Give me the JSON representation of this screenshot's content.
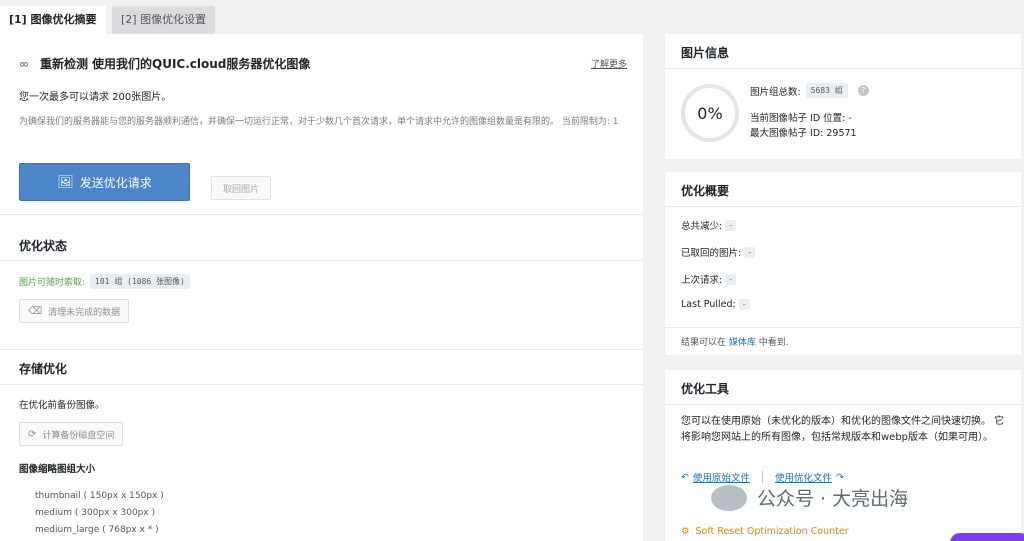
{
  "tabs": {
    "summary": "[1] 图像优化摘要",
    "settings": "[2] 图像优化设置"
  },
  "main": {
    "rescan_label": "重新检测",
    "headline": "使用我们的QUIC.cloud服务器优化图像",
    "learn_more": "了解更多",
    "max_request": "您一次最多可以请求 200张图片。",
    "note": "为确保我们的服务器能与您的服务器顺利通信，并确保一切运行正常，对于少数几个首次请求，单个请求中允许的图像组数量是有限的。 当前限制为: 1",
    "send_button": "发送优化请求",
    "pull_button": "取回图片",
    "status_title": "优化状态",
    "pullable_label": "图片可随时索取:",
    "pullable_value": "101 组 (1086 张图像)",
    "clean_button": "清理未完成的数据",
    "storage_title": "存储优化",
    "backup_text": "在优化前备份图像。",
    "calc_button": "计算备份磁盘空间",
    "thumb_title": "图像缩略图组大小",
    "thumbnails": [
      "thumbnail ( 150px x 150px )",
      "medium ( 300px x 300px )",
      "medium_large ( 768px x * )"
    ]
  },
  "image_info": {
    "title": "图片信息",
    "percent": "0%",
    "total_groups_label": "图片组总数:",
    "total_groups_value": "5683 组",
    "help": "?",
    "current_post": "当前图像帖子 ID 位置: -",
    "max_post": "最大图像帖子 ID: 29571"
  },
  "summary": {
    "title": "优化概要",
    "rows": [
      {
        "label": "总共减少:",
        "value": "-"
      },
      {
        "label": "已取回的图片:",
        "value": "-"
      },
      {
        "label": "上次请求:",
        "value": "-"
      },
      {
        "label": "Last Pulled:",
        "value": "-"
      }
    ],
    "footer_prefix": "结果可以在",
    "footer_link": "媒体库",
    "footer_suffix": "中看到."
  },
  "tools": {
    "title": "优化工具",
    "description": "您可以在使用原始（未优化的版本）和优化的图像文件之间快速切换。 它将影响您网站上的所有图像，包括常规版本和webp版本（如果可用）。",
    "use_original": "使用原始文件",
    "use_optimized": "使用优化文件",
    "soft_reset": "Soft Reset Optimization Counter"
  },
  "watermark": "公众号 · 大亮出海"
}
